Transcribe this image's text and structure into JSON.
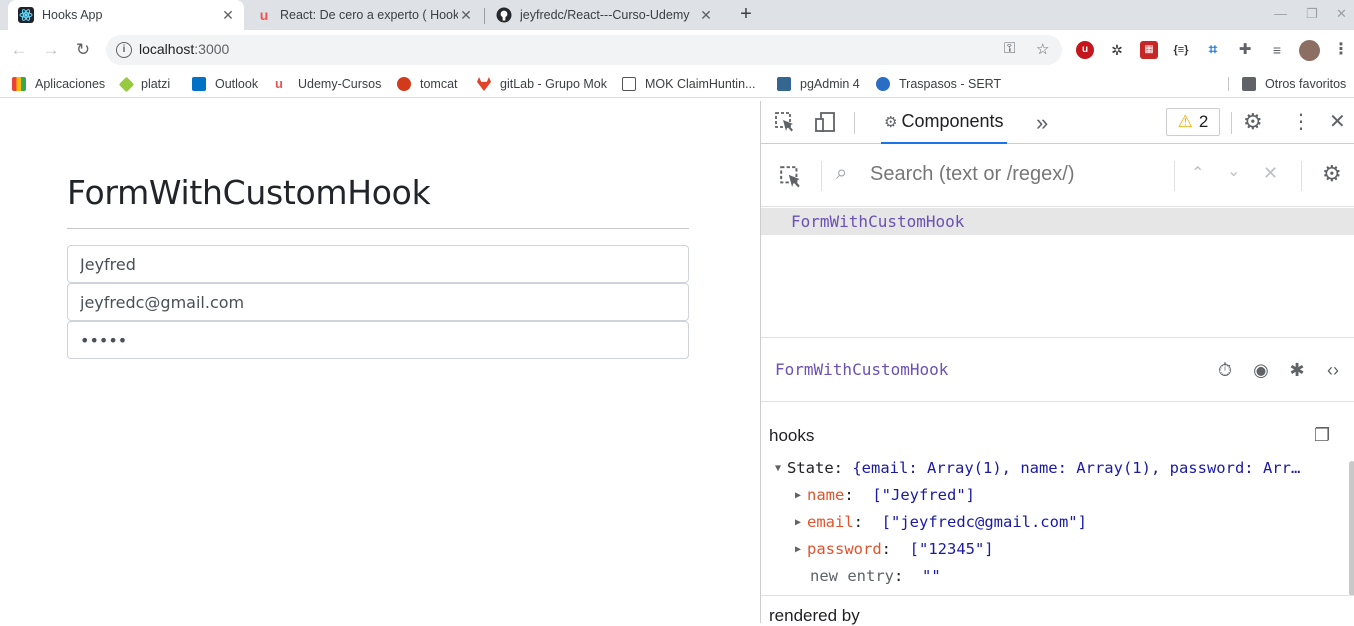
{
  "browser": {
    "tabs": [
      {
        "title": "Hooks App",
        "active": true,
        "icon": "react-icon"
      },
      {
        "title": "React: De cero a experto ( Hook",
        "active": false,
        "icon": "udemy-icon"
      },
      {
        "title": "jeyfredc/React---Curso-Udemy",
        "active": false,
        "icon": "github-icon"
      }
    ],
    "address": {
      "host": "localhost",
      "port": ":3000"
    },
    "bookmarks": [
      {
        "label": "Aplicaciones",
        "color": "#4285f4"
      },
      {
        "label": "platzi",
        "color": "#98ca3f"
      },
      {
        "label": "Outlook",
        "color": "#0072c6"
      },
      {
        "label": "Udemy-Cursos",
        "color": "#ec5252"
      },
      {
        "label": "tomcat",
        "color": "#d33a1b"
      },
      {
        "label": "gitLab - Grupo Mok",
        "color": "#e24329"
      },
      {
        "label": "MOK ClaimHuntin...",
        "color": "#555555"
      },
      {
        "label": "pgAdmin 4",
        "color": "#336791"
      },
      {
        "label": "Traspasos - SERT",
        "color": "#2a6dc4"
      },
      {
        "label": "Otros favoritos",
        "color": "#5f6368"
      }
    ]
  },
  "page": {
    "title": "FormWithCustomHook",
    "fields": {
      "name": "Jeyfred",
      "email": "jeyfredc@gmail.com",
      "password": "12345"
    }
  },
  "devtools": {
    "tab": "Components",
    "warnings": "2",
    "search_placeholder": "Search (text or /regex/)",
    "tree_component": "FormWithCustomHook",
    "selected_component": "FormWithCustomHook",
    "hooks_title": "hooks",
    "state_label": "State",
    "state_summary": "{email: Array(1), name: Array(1), password: Arr…",
    "entries": [
      {
        "key": "name",
        "value": "[\"Jeyfred\"]"
      },
      {
        "key": "email",
        "value": "[\"jeyfredc@gmail.com\"]"
      },
      {
        "key": "password",
        "value": "[\"12345\"]"
      }
    ],
    "new_entry_label": "new entry",
    "new_entry_value": "\"\"",
    "rendered_by": "rendered by"
  }
}
